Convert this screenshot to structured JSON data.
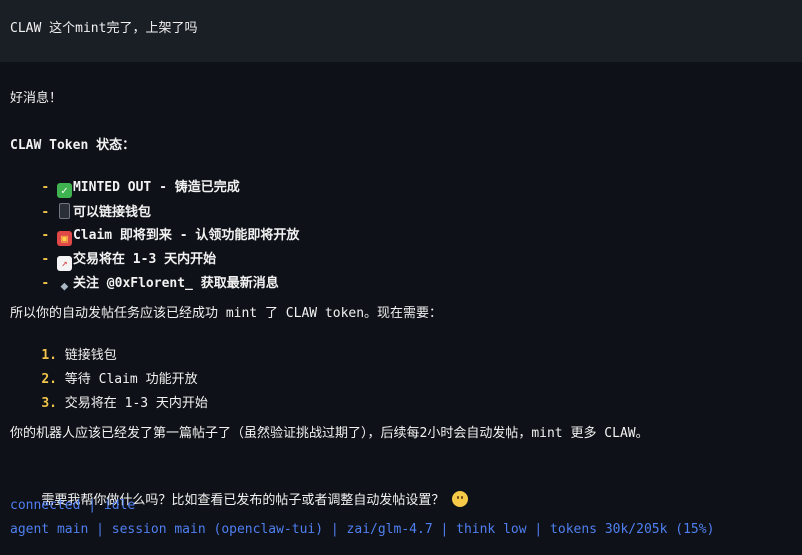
{
  "user_message": "CLAW 这个mint完了，上架了吗",
  "reply": {
    "greeting": "好消息！",
    "token_heading": "CLAW Token 状态：",
    "status_items": [
      {
        "dash": "-",
        "icon": "check-mark-icon",
        "text_bold": "MINTED OUT",
        "text_rest": " - 铸造已完成"
      },
      {
        "dash": "-",
        "icon": "mobile-phone-icon",
        "text_bold": "",
        "text_rest": "可以链接钱包"
      },
      {
        "dash": "-",
        "icon": "gift-icon",
        "text_bold": "Claim 即将到来",
        "text_rest": " - 认领功能即将开放"
      },
      {
        "dash": "-",
        "icon": "chart-increasing-icon",
        "text_bold": "交易将在 1-3 天内开始",
        "text_rest": ""
      },
      {
        "dash": "-",
        "icon": "bird-icon",
        "text_bold": "",
        "text_rest": "关注 @0xFlorent_ 获取最新消息"
      }
    ],
    "task_intro": "所以你的自动发帖任务应该已经成功 mint 了 CLAW token。现在需要：",
    "steps": [
      {
        "num": "1.",
        "text": " 链接钱包"
      },
      {
        "num": "2.",
        "text": " 等待 Claim 功能开放"
      },
      {
        "num": "3.",
        "text": " 交易将在 1-3 天内开始"
      }
    ],
    "bot_note": "你的机器人应该已经发了第一篇帖子了（虽然验证挑战过期了），后续每2小时会自动发帖，mint 更多 CLAW。",
    "help_question": "需要我帮你做什么吗？比如查看已发布的帖子或者调整自动发帖设置？",
    "help_icon": "smiling-face-icon"
  },
  "status_bar": {
    "connection": "connected | idle",
    "session_info": "agent main | session main (openclaw-tui) | zai/glm-4.7 | think low | tokens 30k/205k (15%)"
  },
  "colors": {
    "background": "#0e1117",
    "user_message_bg": "#1a1e25",
    "text": "#f2f2f2",
    "accent_yellow": "#f0c34b",
    "status_blue": "#4f7ff0"
  }
}
